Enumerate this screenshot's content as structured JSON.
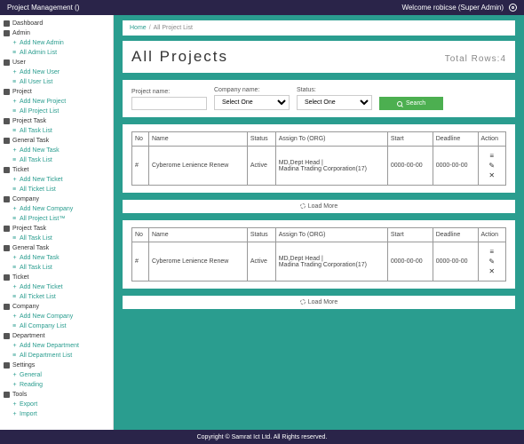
{
  "header": {
    "app_title": "Project Management ()",
    "welcome": "Welcome robicse (Super Admin)"
  },
  "sidebar": {
    "groups": [
      {
        "head": "Dashboard",
        "items": []
      },
      {
        "head": "Admin",
        "items": [
          {
            "t": "plus",
            "l": "Add New Admin"
          },
          {
            "t": "bars",
            "l": "All Admin List"
          }
        ]
      },
      {
        "head": "User",
        "items": [
          {
            "t": "plus",
            "l": "Add New User"
          },
          {
            "t": "bars",
            "l": "All User List"
          }
        ]
      },
      {
        "head": "Project",
        "items": [
          {
            "t": "plus",
            "l": "Add New Project"
          },
          {
            "t": "bars",
            "l": "All Project List"
          }
        ]
      },
      {
        "head": "Project Task",
        "items": [
          {
            "t": "bars",
            "l": "All Task List"
          }
        ]
      },
      {
        "head": "General Task",
        "items": [
          {
            "t": "plus",
            "l": "Add New Task"
          },
          {
            "t": "bars",
            "l": "All Task List"
          }
        ]
      },
      {
        "head": "Ticket",
        "items": [
          {
            "t": "plus",
            "l": "Add New Ticket"
          },
          {
            "t": "bars",
            "l": "All Ticket List"
          }
        ]
      },
      {
        "head": "Company",
        "items": [
          {
            "t": "plus",
            "l": "Add New Company"
          },
          {
            "t": "bars",
            "l": "All Project List™"
          }
        ]
      },
      {
        "head": "Project Task",
        "items": [
          {
            "t": "bars",
            "l": "All Task List"
          }
        ]
      },
      {
        "head": "General Task",
        "items": [
          {
            "t": "plus",
            "l": "Add New Task"
          },
          {
            "t": "bars",
            "l": "All Task List"
          }
        ]
      },
      {
        "head": "Ticket",
        "items": [
          {
            "t": "plus",
            "l": "Add New Ticket"
          },
          {
            "t": "bars",
            "l": "All Ticket List"
          }
        ]
      },
      {
        "head": "Company",
        "items": [
          {
            "t": "plus",
            "l": "Add New Company"
          },
          {
            "t": "bars",
            "l": "All Company List"
          }
        ]
      },
      {
        "head": "Department",
        "items": [
          {
            "t": "plus",
            "l": "Add New Department"
          },
          {
            "t": "bars",
            "l": "All Department List"
          }
        ]
      },
      {
        "head": "Settings",
        "items": [
          {
            "t": "plus",
            "l": "General"
          },
          {
            "t": "plus",
            "l": "Reading"
          }
        ]
      },
      {
        "head": "Tools",
        "items": [
          {
            "t": "plus",
            "l": "Export"
          },
          {
            "t": "plus",
            "l": "Import"
          }
        ]
      }
    ]
  },
  "breadcrumb": {
    "home": "Home",
    "current": "All Project List"
  },
  "page": {
    "title": "All Projects",
    "total_label": "Total Rows:",
    "total_count": "4"
  },
  "filters": {
    "project_label": "Project name:",
    "company_label": "Company name:",
    "status_label": "Status:",
    "select_one": "Select One",
    "search": "Search"
  },
  "table": {
    "headers": {
      "no": "No",
      "name": "Name",
      "status": "Status",
      "assign": "Assign To (ORG)",
      "start": "Start",
      "deadline": "Deadline",
      "action": "Action"
    },
    "row": {
      "no": "#",
      "name": "Cyberome Lenience Renew",
      "status": "Active",
      "assign": "MD,Dept Head |\nMadina Trading Corporation(17)",
      "start": "0000-00-00",
      "deadline": "0000-00-00"
    }
  },
  "loadmore": "Load More",
  "footer": "Copyright © Samrat Ict Ltd. All Rights reserved."
}
